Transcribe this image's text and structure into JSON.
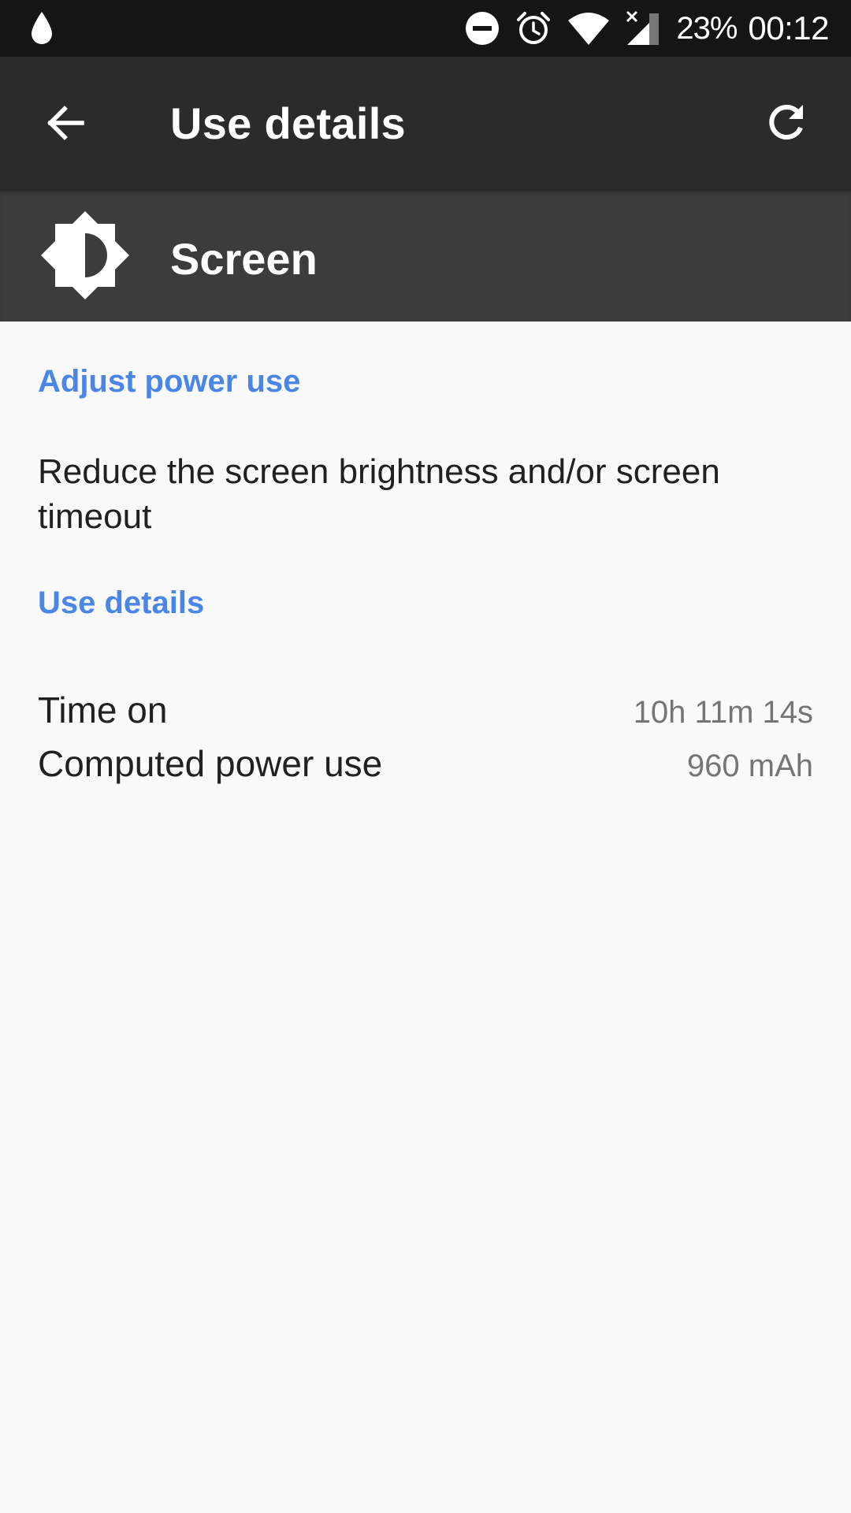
{
  "status_bar": {
    "icons": [
      "water-drop-icon",
      "do-not-disturb-icon",
      "alarm-icon",
      "wifi-icon",
      "signal-icon"
    ],
    "battery": "23%",
    "time": "00:12"
  },
  "app_bar": {
    "back_icon": "arrow-back-icon",
    "title": "Use details",
    "refresh_icon": "refresh-icon"
  },
  "header": {
    "icon": "brightness-icon",
    "title": "Screen"
  },
  "content": {
    "adjust_title": "Adjust power use",
    "adjust_description": "Reduce the screen brightness and/or screen timeout",
    "details_title": "Use details",
    "details": [
      {
        "label": "Time on",
        "value": "10h 11m 14s"
      },
      {
        "label": "Computed power use",
        "value": "960 mAh"
      }
    ]
  },
  "colors": {
    "status_bar": "#151515",
    "app_bar": "#2b2b2b",
    "header": "#3c3c3c",
    "accent": "#4a86e8",
    "background": "#fafafa"
  }
}
